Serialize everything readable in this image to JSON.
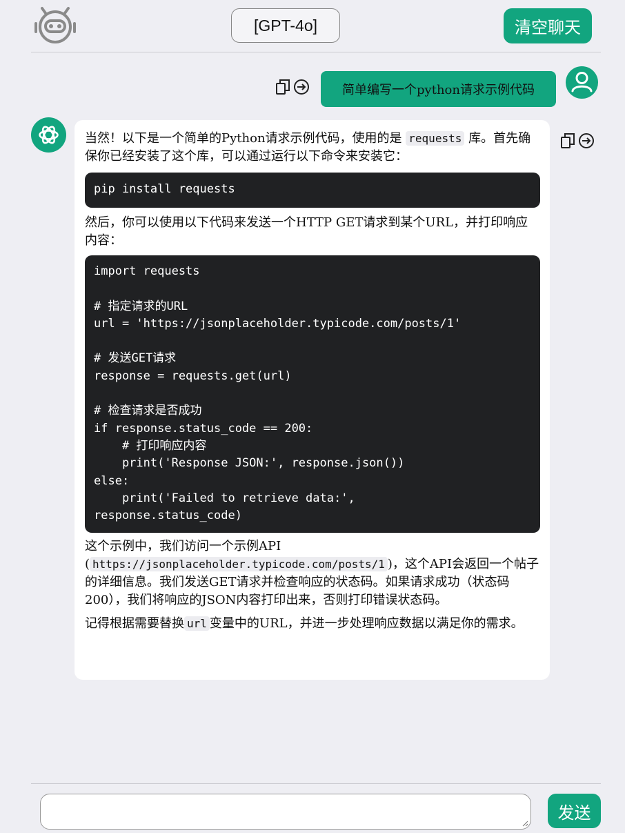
{
  "header": {
    "model_label": "[GPT-4o]",
    "clear_label": "清空聊天"
  },
  "user_message": {
    "text": "简单编写一个python请求示例代码"
  },
  "bot_message": {
    "p1_a": "当然！以下是一个简单的Python请求示例代码，使用的是",
    "p1_code": "requests",
    "p1_b": "库。首先确保你已经安装了这个库，可以通过运行以下命令来安装它：",
    "code1": "pip install requests",
    "p2": "然后，你可以使用以下代码来发送一个HTTP GET请求到某个URL，并打印响应内容：",
    "code2": "import requests\n\n# 指定请求的URL\nurl = 'https://jsonplaceholder.typicode.com/posts/1'\n\n# 发送GET请求\nresponse = requests.get(url)\n\n# 检查请求是否成功\nif response.status_code == 200:\n    # 打印响应内容\n    print('Response JSON:', response.json())\nelse:\n    print('Failed to retrieve data:',\nresponse.status_code)",
    "p3_a": "这个示例中，我们访问一个示例API",
    "p3_paren_open": "(",
    "p3_code": "https://jsonplaceholder.typicode.com/posts/1",
    "p3_b": ")，这个API会返回一个帖子的详细信息。我们发送GET请求并检查响应的状态码。如果请求成功（状态码200），我们将响应的JSON内容打印出来，否则打印错误状态码。",
    "p4_a": "记得根据需要替换",
    "p4_code": "url",
    "p4_b": "变量中的URL，并进一步处理响应数据以满足你的需求。"
  },
  "input": {
    "placeholder": "",
    "send_label": "发送"
  },
  "colors": {
    "accent": "#12a57f",
    "background": "#eeeef3",
    "code_bg": "#202123"
  },
  "icons": [
    "robot-icon",
    "copy-icon",
    "share-icon",
    "user-icon",
    "openai-icon"
  ]
}
